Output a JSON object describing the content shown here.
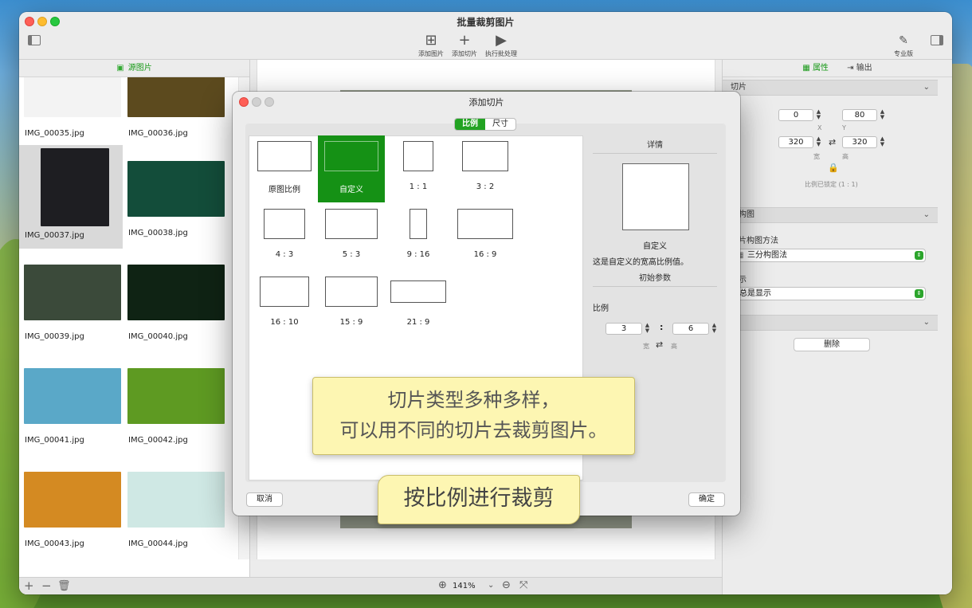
{
  "window": {
    "title": "批量裁剪图片"
  },
  "toolbar": {
    "add_image": "添加图片",
    "add_slice": "添加切片",
    "run_batch": "执行批处理",
    "pro": "专业版"
  },
  "left_panel": {
    "header": "源图片",
    "files": [
      {
        "name": "IMG_00035.jpg",
        "color": "#f3f3f3"
      },
      {
        "name": "IMG_00036.jpg",
        "color": "#5c4a1e"
      },
      {
        "name": "IMG_00037.jpg",
        "color": "#1e1e22"
      },
      {
        "name": "IMG_00038.jpg",
        "color": "#134d3a"
      },
      {
        "name": "IMG_00039.jpg",
        "color": "#3b4a3a"
      },
      {
        "name": "IMG_00040.jpg",
        "color": "#0f2314"
      },
      {
        "name": "IMG_00041.jpg",
        "color": "#5aa8c8"
      },
      {
        "name": "IMG_00042.jpg",
        "color": "#5e9a22"
      },
      {
        "name": "IMG_00043.jpg",
        "color": "#d48a22"
      },
      {
        "name": "IMG_00044.jpg",
        "color": "#cfe8e4"
      }
    ],
    "selected_index": 2
  },
  "center": {
    "zoom": "141%"
  },
  "right_panel": {
    "tab_properties": "属性",
    "tab_output": "输出",
    "section_slice": "切片",
    "x": "0",
    "y": "80",
    "x_label": "X",
    "y_label": "Y",
    "width": "320",
    "height": "320",
    "width_label": "宽",
    "height_label": "高",
    "ratio_locked": "比例已锁定 (1 : 1)",
    "section_composition": "片构图",
    "composition_method_label": "图片构图方法",
    "composition_method": "三分构图法",
    "display_label": "显示",
    "display_value": "总是显示",
    "section_action": "作",
    "delete_button": "删除"
  },
  "modal": {
    "title": "添加切片",
    "seg_ratio": "比例",
    "seg_size": "尺寸",
    "ratios": [
      {
        "label": "原图比例",
        "w": 68,
        "h": 38
      },
      {
        "label": "自定义",
        "w": 68,
        "h": 38
      },
      {
        "label": "1 : 1",
        "w": 38,
        "h": 38
      },
      {
        "label": "3 : 2",
        "w": 58,
        "h": 38
      },
      {
        "label": "4 : 3",
        "w": 52,
        "h": 38
      },
      {
        "label": "5 : 3",
        "w": 66,
        "h": 38
      },
      {
        "label": "9 : 16",
        "w": 22,
        "h": 38
      },
      {
        "label": "16 : 9",
        "w": 70,
        "h": 38
      },
      {
        "label": "16 : 10",
        "w": 62,
        "h": 38
      },
      {
        "label": "15 : 9",
        "w": 66,
        "h": 38
      },
      {
        "label": "21 : 9",
        "w": 70,
        "h": 28
      }
    ],
    "selected_ratio": 1,
    "details_header": "详情",
    "detail_name": "自定义",
    "detail_desc": "这是自定义的宽高比例值。",
    "initial_params": "初始参数",
    "ratio_label": "比例",
    "ratio_w": "3",
    "ratio_h": "6",
    "ratio_colon": ":",
    "w_label": "宽",
    "h_label": "高",
    "cancel": "取消",
    "ok": "确定"
  },
  "callouts": {
    "line1": "切片类型多种多样，",
    "line2": "可以用不同的切片去裁剪图片。",
    "tag": "按比例进行裁剪"
  }
}
